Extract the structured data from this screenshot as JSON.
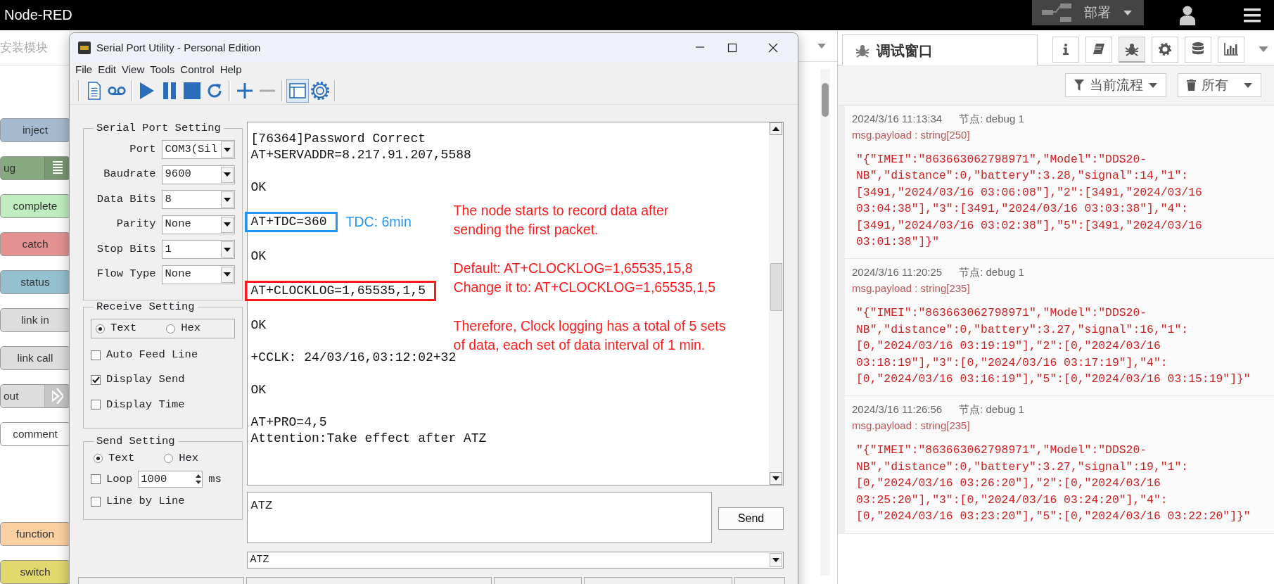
{
  "app": {
    "title": "Node-RED",
    "deploy": {
      "label": "部署"
    }
  },
  "palette": {
    "search_placeholder": "安装模块",
    "groups": [
      {
        "nodes": [
          {
            "label": "inject",
            "color": "#a6bbcf",
            "kind": "plain"
          },
          {
            "label": "ug",
            "color": "#87a980",
            "kind": "icon_right"
          },
          {
            "label": "complete",
            "color": "#c0edc0",
            "kind": "plain"
          },
          {
            "label": "catch",
            "color": "#e49191",
            "kind": "plain"
          },
          {
            "label": "status",
            "color": "#94c1d0",
            "kind": "plain"
          },
          {
            "label": "link in",
            "color": "#dddddd",
            "kind": "plain"
          },
          {
            "label": "link call",
            "color": "#dddddd",
            "kind": "plain"
          },
          {
            "label": "out",
            "color": "#dddddd",
            "kind": "icon_right"
          },
          {
            "label": "comment",
            "color": "#ffffff",
            "kind": "plain"
          }
        ]
      },
      {
        "nodes": [
          {
            "label": "function",
            "color": "#fdd0a2",
            "kind": "plain"
          },
          {
            "label": "switch",
            "color": "#e2d96e",
            "kind": "plain"
          }
        ]
      }
    ]
  },
  "serial_window": {
    "title": "Serial Port Utility - Personal Edition",
    "menus": [
      "File",
      "Edit",
      "View",
      "Tools",
      "Control",
      "Help"
    ],
    "toolbar": [
      [
        {
          "kind": "document",
          "pressed": false,
          "disabled": false
        },
        {
          "kind": "tape",
          "pressed": false,
          "disabled": false
        }
      ],
      [
        {
          "kind": "play",
          "pressed": false,
          "disabled": false
        },
        {
          "kind": "pause",
          "pressed": false,
          "disabled": false
        },
        {
          "kind": "stop",
          "pressed": false,
          "disabled": false
        },
        {
          "kind": "refresh",
          "pressed": false,
          "disabled": false
        }
      ],
      [
        {
          "kind": "plus",
          "pressed": false,
          "disabled": false
        },
        {
          "kind": "minus",
          "pressed": false,
          "disabled": true
        }
      ],
      [
        {
          "kind": "window",
          "pressed": true,
          "disabled": false
        },
        {
          "kind": "gear",
          "pressed": false,
          "disabled": false
        }
      ]
    ],
    "port_setting": {
      "title": "Serial Port Setting",
      "fields": [
        {
          "label": "Port",
          "value": "COM3(Sil"
        },
        {
          "label": "Baudrate",
          "value": "9600"
        },
        {
          "label": "Data Bits",
          "value": "8"
        },
        {
          "label": "Parity",
          "value": "None"
        },
        {
          "label": "Stop Bits",
          "value": "1"
        },
        {
          "label": "Flow Type",
          "value": "None"
        }
      ]
    },
    "receive_setting": {
      "title": "Receive Setting",
      "modes": [
        {
          "label": "Text",
          "selected": true
        },
        {
          "label": "Hex",
          "selected": false
        }
      ],
      "options": [
        {
          "label": "Auto Feed Line",
          "checked": false
        },
        {
          "label": "Display Send",
          "checked": true
        },
        {
          "label": "Display Time",
          "checked": false
        }
      ]
    },
    "send_setting": {
      "title": "Send Setting",
      "modes": [
        {
          "label": "Text",
          "selected": true
        },
        {
          "label": "Hex",
          "selected": false
        }
      ],
      "loop": {
        "label": "Loop",
        "checked": false,
        "value": "1000",
        "unit": "ms"
      },
      "line_by_line": {
        "label": "Line by Line",
        "checked": false
      }
    },
    "log": {
      "blocks": [
        {
          "lines": [
            "[76364]Password Correct",
            "AT+SERVADDR=8.217.91.207,5588"
          ]
        },
        {
          "lines": [
            "OK"
          ]
        },
        {
          "lines": [
            "AT+TDC=360"
          ],
          "color": "#2196f3",
          "note": "TDC: 6min"
        },
        {
          "lines": [
            "OK"
          ]
        },
        {
          "lines": [
            "AT+CLOCKLOG=1,65535,1,5"
          ],
          "color": "#ff1a1a"
        },
        {
          "lines": [
            "OK"
          ]
        },
        {
          "lines": [
            "+CCLK: 24/03/16,03:12:02+32"
          ]
        },
        {
          "lines": [
            "OK"
          ]
        },
        {
          "lines": [
            "AT+PRO=4,5",
            "Attention:Take effect after ATZ"
          ]
        }
      ]
    },
    "annotation": {
      "color": "#ff1a1a",
      "paragraphs": [
        [
          "The node starts to record data after",
          "sending the first packet."
        ],
        [
          "Default: AT+CLOCKLOG=1,65535,15,8",
          "Change it to: AT+CLOCKLOG=1,65535,1,5"
        ],
        [
          "Therefore, Clock logging has a total of 5 sets",
          "of data, each set of data interval of 1 min."
        ]
      ]
    },
    "input_value": "ATZ",
    "send_button": "Send",
    "history_value": "ATZ"
  },
  "debug_sidebar": {
    "tab_label": "调试窗口",
    "tools": [
      {
        "kind": "info",
        "selected": false
      },
      {
        "kind": "book",
        "selected": false
      },
      {
        "kind": "bug",
        "selected": true
      },
      {
        "kind": "gear",
        "selected": false
      },
      {
        "kind": "database",
        "selected": false
      },
      {
        "kind": "chart",
        "selected": false
      }
    ],
    "filter_label": "当前流程",
    "clear_label": "所有",
    "messages": [
      {
        "time": "2024/3/16 11:13:34",
        "node": "节点: debug 1",
        "type": "msg.payload : string[250]",
        "payload": "\"{\"IMEI\":\"863663062798971\",\"Model\":\"DDS20-NB\",\"distance\":0,\"battery\":3.28,\"signal\":14,\"1\":[3491,\"2024/03/16 03:06:08\"],\"2\":[3491,\"2024/03/16 03:04:38\"],\"3\":[3491,\"2024/03/16 03:03:38\"],\"4\":[3491,\"2024/03/16 03:02:38\"],\"5\":[3491,\"2024/03/16 03:01:38\"]}\""
      },
      {
        "time": "2024/3/16 11:20:25",
        "node": "节点: debug 1",
        "type": "msg.payload : string[235]",
        "payload": "\"{\"IMEI\":\"863663062798971\",\"Model\":\"DDS20-NB\",\"distance\":0,\"battery\":3.27,\"signal\":16,\"1\":[0,\"2024/03/16 03:19:19\"],\"2\":[0,\"2024/03/16 03:18:19\"],\"3\":[0,\"2024/03/16 03:17:19\"],\"4\":[0,\"2024/03/16 03:16:19\"],\"5\":[0,\"2024/03/16 03:15:19\"]}\""
      },
      {
        "time": "2024/3/16 11:26:56",
        "node": "节点: debug 1",
        "type": "msg.payload : string[235]",
        "payload": "\"{\"IMEI\":\"863663062798971\",\"Model\":\"DDS20-NB\",\"distance\":0,\"battery\":3.27,\"signal\":19,\"1\":[0,\"2024/03/16 03:26:20\"],\"2\":[0,\"2024/03/16 03:25:20\"],\"3\":[0,\"2024/03/16 03:24:20\"],\"4\":[0,\"2024/03/16 03:23:20\"],\"5\":[0,\"2024/03/16 03:22:20\"]}\""
      }
    ]
  }
}
